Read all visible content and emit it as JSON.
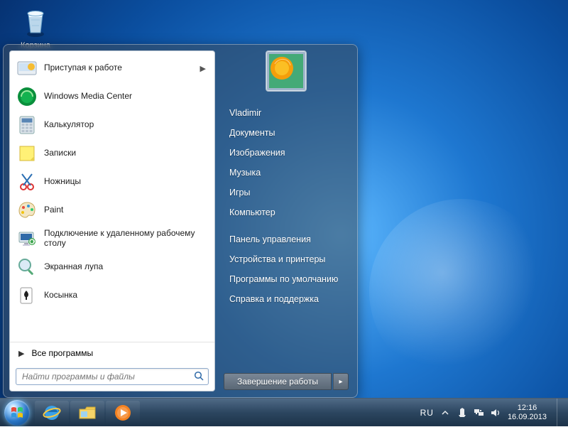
{
  "desktop": {
    "recycle_bin_label": "Корзина"
  },
  "start_menu": {
    "programs": [
      {
        "label": "Приступая к работе",
        "has_submenu": true,
        "icon": "getting-started"
      },
      {
        "label": "Windows Media Center",
        "has_submenu": false,
        "icon": "wmc"
      },
      {
        "label": "Калькулятор",
        "has_submenu": false,
        "icon": "calculator"
      },
      {
        "label": "Записки",
        "has_submenu": false,
        "icon": "sticky-notes"
      },
      {
        "label": "Ножницы",
        "has_submenu": false,
        "icon": "snipping-tool"
      },
      {
        "label": "Paint",
        "has_submenu": false,
        "icon": "paint"
      },
      {
        "label": "Подключение к удаленному рабочему столу",
        "has_submenu": false,
        "icon": "remote-desktop"
      },
      {
        "label": "Экранная лупа",
        "has_submenu": false,
        "icon": "magnifier"
      },
      {
        "label": "Косынка",
        "has_submenu": false,
        "icon": "solitaire"
      }
    ],
    "all_programs_label": "Все программы",
    "search_placeholder": "Найти программы и файлы",
    "right": {
      "user_name": "Vladimir",
      "items": [
        "Документы",
        "Изображения",
        "Музыка",
        "Игры",
        "Компьютер",
        "Панель управления",
        "Устройства и принтеры",
        "Программы по умолчанию",
        "Справка и поддержка"
      ],
      "shutdown_label": "Завершение работы"
    }
  },
  "taskbar": {
    "pinned": [
      "internet-explorer",
      "file-explorer",
      "windows-media-player"
    ],
    "tray": {
      "language": "RU",
      "time": "12:16",
      "date": "16.09.2013"
    }
  }
}
